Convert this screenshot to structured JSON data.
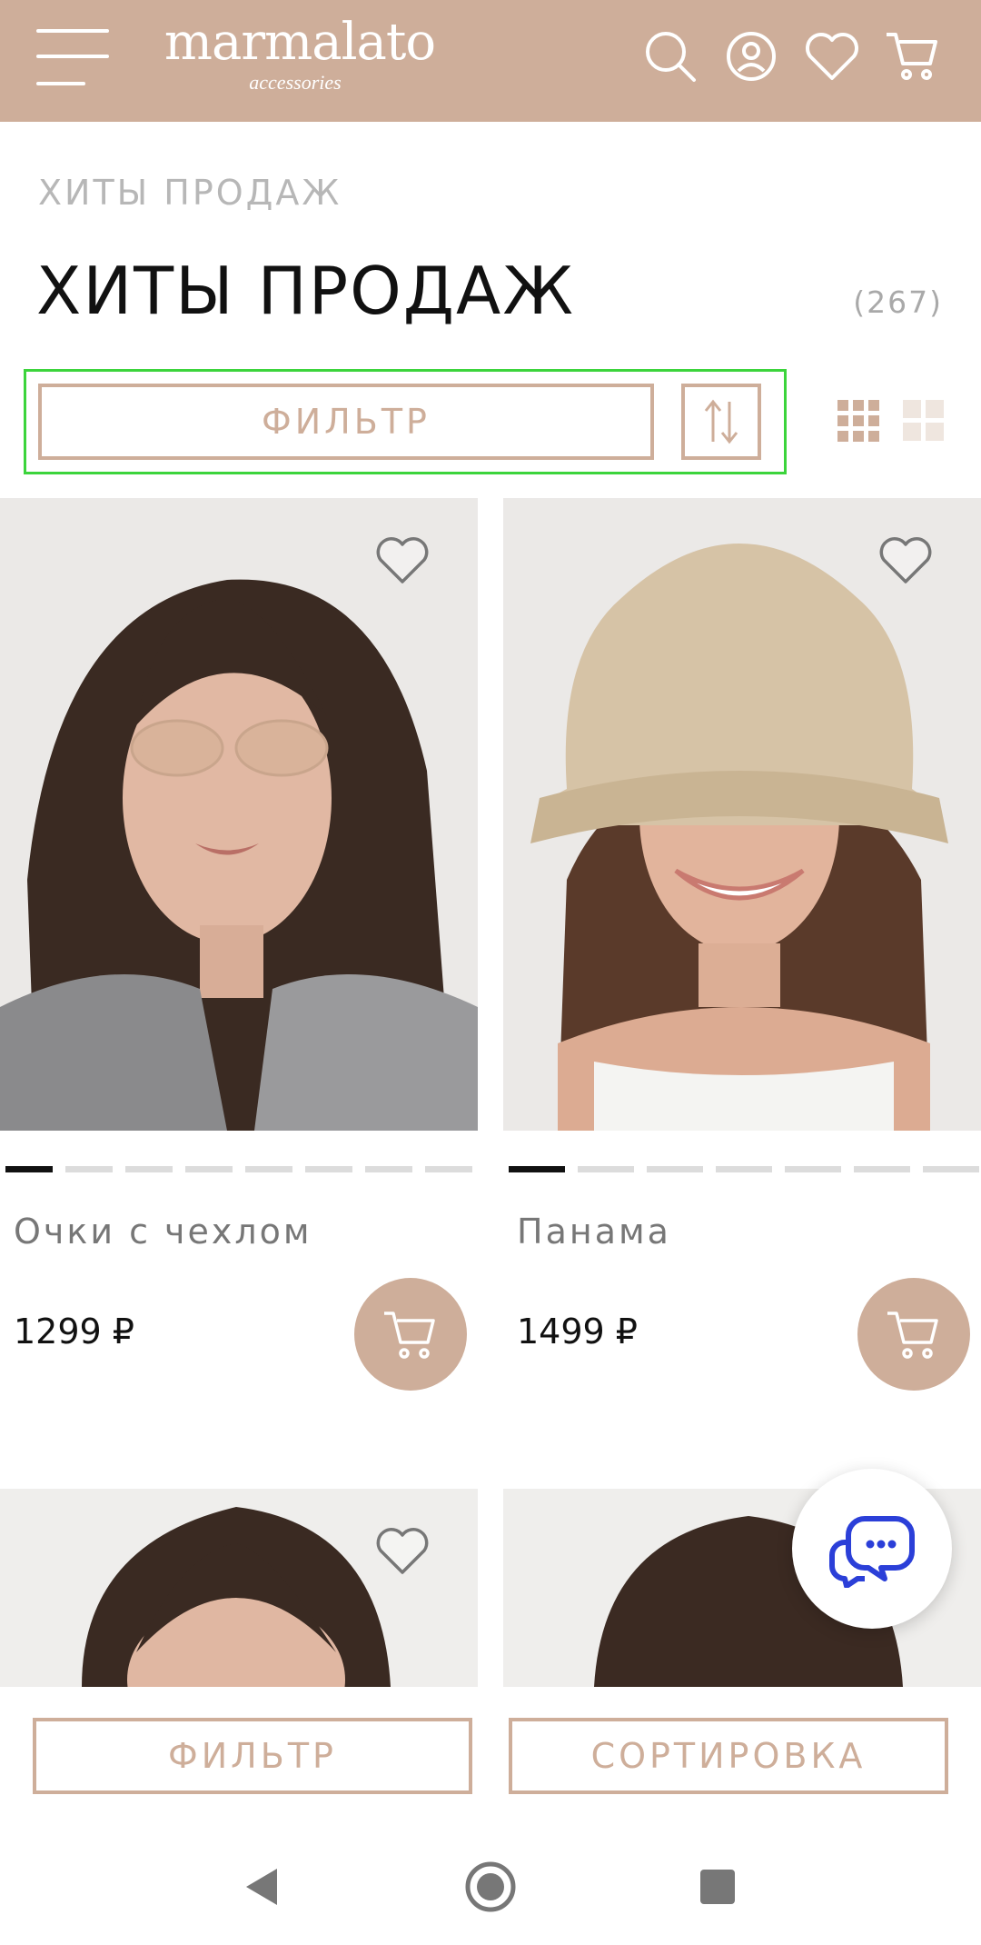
{
  "header": {
    "logo_name": "marmalato",
    "logo_sub": "accessories",
    "icons": [
      "menu-icon",
      "search-icon",
      "user-icon",
      "heart-icon",
      "cart-icon"
    ]
  },
  "breadcrumb": "ХИТЫ ПРОДАЖ",
  "page_title": "ХИТЫ ПРОДАЖ",
  "count": "(267)",
  "toolbar": {
    "filter_label": "ФИЛЬТР",
    "sort_icon": "sort-arrows-icon",
    "view_icons": [
      "grid-3x3-icon",
      "grid-2x2-icon"
    ]
  },
  "products": [
    {
      "name": "Очки с чехлом",
      "price": "1299 ₽"
    },
    {
      "name": "Панама",
      "price": "1499 ₽"
    }
  ],
  "bottom_bar": {
    "filter_label": "ФИЛЬТР",
    "sort_label": "СОРТИРОВКА"
  },
  "colors": {
    "brand": "#ceae9a",
    "chat_icon": "#2b3fd8",
    "highlight": "#3cd43c"
  }
}
